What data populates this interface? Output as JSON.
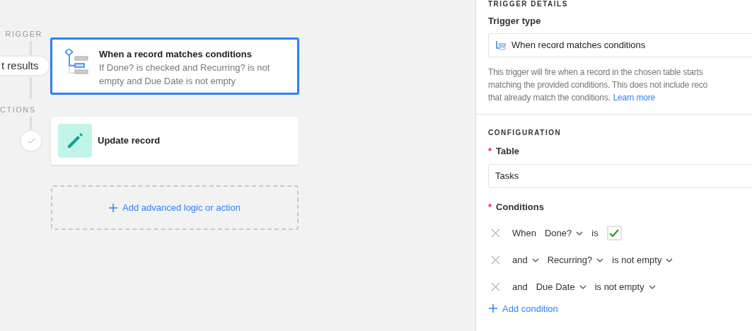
{
  "canvas": {
    "trigger_label": "RIGGER",
    "results_pill": "t results",
    "actions_label": "CTIONS",
    "trigger_card": {
      "title": "When a record matches conditions",
      "description": "If Done? is checked and Recurring? is not empty and Due Date is not empty",
      "selected": true
    },
    "action_step": {
      "done": true
    },
    "action_card": {
      "title": "Update record",
      "selected": false
    },
    "add_step": "Add advanced logic or action"
  },
  "panel": {
    "section_title": "TRIGGER DETAILS",
    "trigger_type_label": "Trigger type",
    "trigger_type_value": "When record matches conditions",
    "help_text": "This trigger will fire when a record in the chosen table starts",
    "help_text_1": "matching the provided conditions. This does not include reco",
    "help_text_2": "that already match the conditions.",
    "learn_more": "Learn more",
    "configuration_title": "CONFIGURATION",
    "required_mark": "*",
    "table_label": "Table",
    "table_value": "Tasks",
    "conditions_label": "Conditions",
    "conditions": [
      {
        "parts": [
          {
            "text": "When",
            "dropdown": false
          },
          {
            "text": "Done?",
            "dropdown": true
          },
          {
            "text": "is",
            "dropdown": false
          }
        ],
        "value": {
          "kind": "checkbox",
          "checked": true
        }
      },
      {
        "parts": [
          {
            "text": "and",
            "dropdown": true
          },
          {
            "text": "Recurring?",
            "dropdown": true
          },
          {
            "text": "is not empty",
            "dropdown": true
          }
        ]
      },
      {
        "parts": [
          {
            "text": "and",
            "dropdown": false
          },
          {
            "text": "Due Date",
            "dropdown": true
          },
          {
            "text": "is not empty",
            "dropdown": true
          }
        ]
      }
    ],
    "add_condition": "Add condition"
  }
}
